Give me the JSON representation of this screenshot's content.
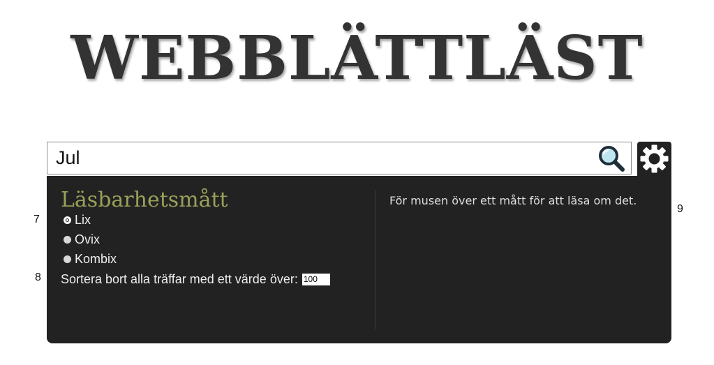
{
  "logo": {
    "text": "WEBBLÄTTLÄST"
  },
  "search": {
    "value": "Jul",
    "search_icon": "search-icon",
    "settings_icon": "gear-icon"
  },
  "settings_panel": {
    "title": "Läsbarhetsmått",
    "options": [
      {
        "label": "Lix",
        "selected": true
      },
      {
        "label": "Ovix",
        "selected": false
      },
      {
        "label": "Kombix",
        "selected": false
      }
    ],
    "filter_label": "Sortera bort alla träffar med ett värde över:",
    "filter_value": "100",
    "help_text": "För musen över ett mått för att läsa om det."
  },
  "annotations": {
    "seven": "7",
    "eight": "8",
    "nine": "9"
  },
  "colors": {
    "panel_bg": "#222222",
    "title_color": "#9aa05a",
    "logo_color": "#333333"
  }
}
